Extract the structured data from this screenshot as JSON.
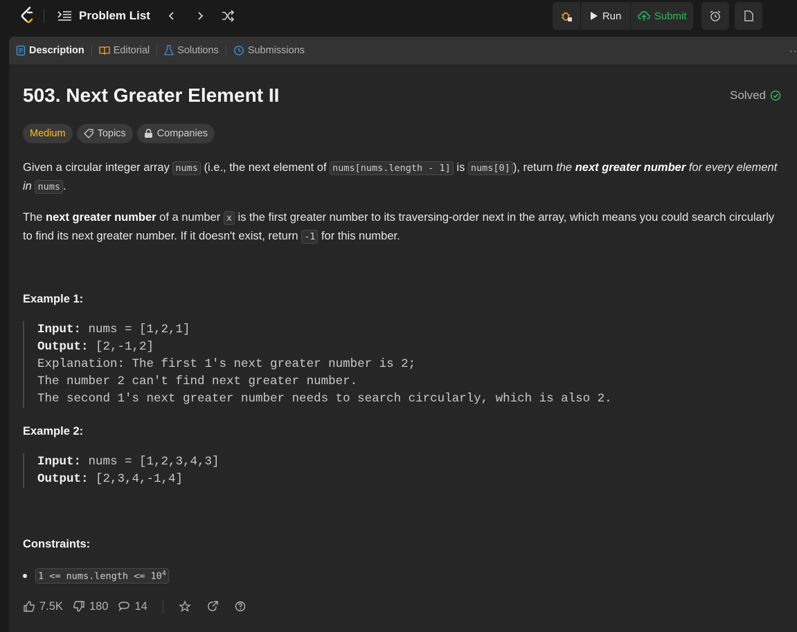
{
  "topbar": {
    "problem_list_label": "Problem List",
    "run_label": "Run",
    "submit_label": "Submit"
  },
  "tabs": [
    {
      "label": "Description",
      "icon": "description-icon",
      "active": true
    },
    {
      "label": "Editorial",
      "icon": "book-icon"
    },
    {
      "label": "Solutions",
      "icon": "flask-icon"
    },
    {
      "label": "Submissions",
      "icon": "history-icon"
    }
  ],
  "problem": {
    "title": "503. Next Greater Element II",
    "status": "Solved",
    "difficulty": "Medium",
    "topics_label": "Topics",
    "companies_label": "Companies"
  },
  "description": {
    "p1": {
      "t1": "Given a circular integer array ",
      "c1": "nums",
      "t2": " (i.e., the next element of ",
      "c2": "nums[nums.length - 1]",
      "t3": " is ",
      "c3": "nums[0]",
      "t4": "), return ",
      "i1": "the ",
      "b1": "next greater number",
      "i2": " for every element in ",
      "c4": "nums",
      "t5": "."
    },
    "p2": {
      "t1": "The ",
      "b1": "next greater number",
      "t2": " of a number ",
      "c1": "x",
      "t3": " is the first greater number to its traversing-order next in the array, which means you could search circularly to find its next greater number. If it doesn't exist, return ",
      "c2": "-1",
      "t4": " for this number."
    }
  },
  "examples": [
    {
      "title": "Example 1:",
      "input_label": "Input:",
      "input": " nums = [1,2,1]",
      "output_label": "Output:",
      "output": " [2,-1,2]",
      "explanation": [
        "Explanation: The first 1's next greater number is 2;",
        "The number 2 can't find next greater number.",
        "The second 1's next greater number needs to search circularly, which is also 2."
      ]
    },
    {
      "title": "Example 2:",
      "input_label": "Input:",
      "input": " nums = [1,2,3,4,3]",
      "output_label": "Output:",
      "output": " [2,3,4,-1,4]"
    }
  ],
  "constraints": {
    "title": "Constraints:",
    "item_base": "1 <= nums.length <= 10",
    "item_exp": "4"
  },
  "stats": {
    "likes": "7.5K",
    "dislikes": "180",
    "comments": "14"
  },
  "colors": {
    "accent_submit": "#2cbb5d",
    "difficulty_medium": "#ffc01e",
    "tab_icon_blue": "#3e8fd8",
    "logo_orange": "#ffa116"
  }
}
